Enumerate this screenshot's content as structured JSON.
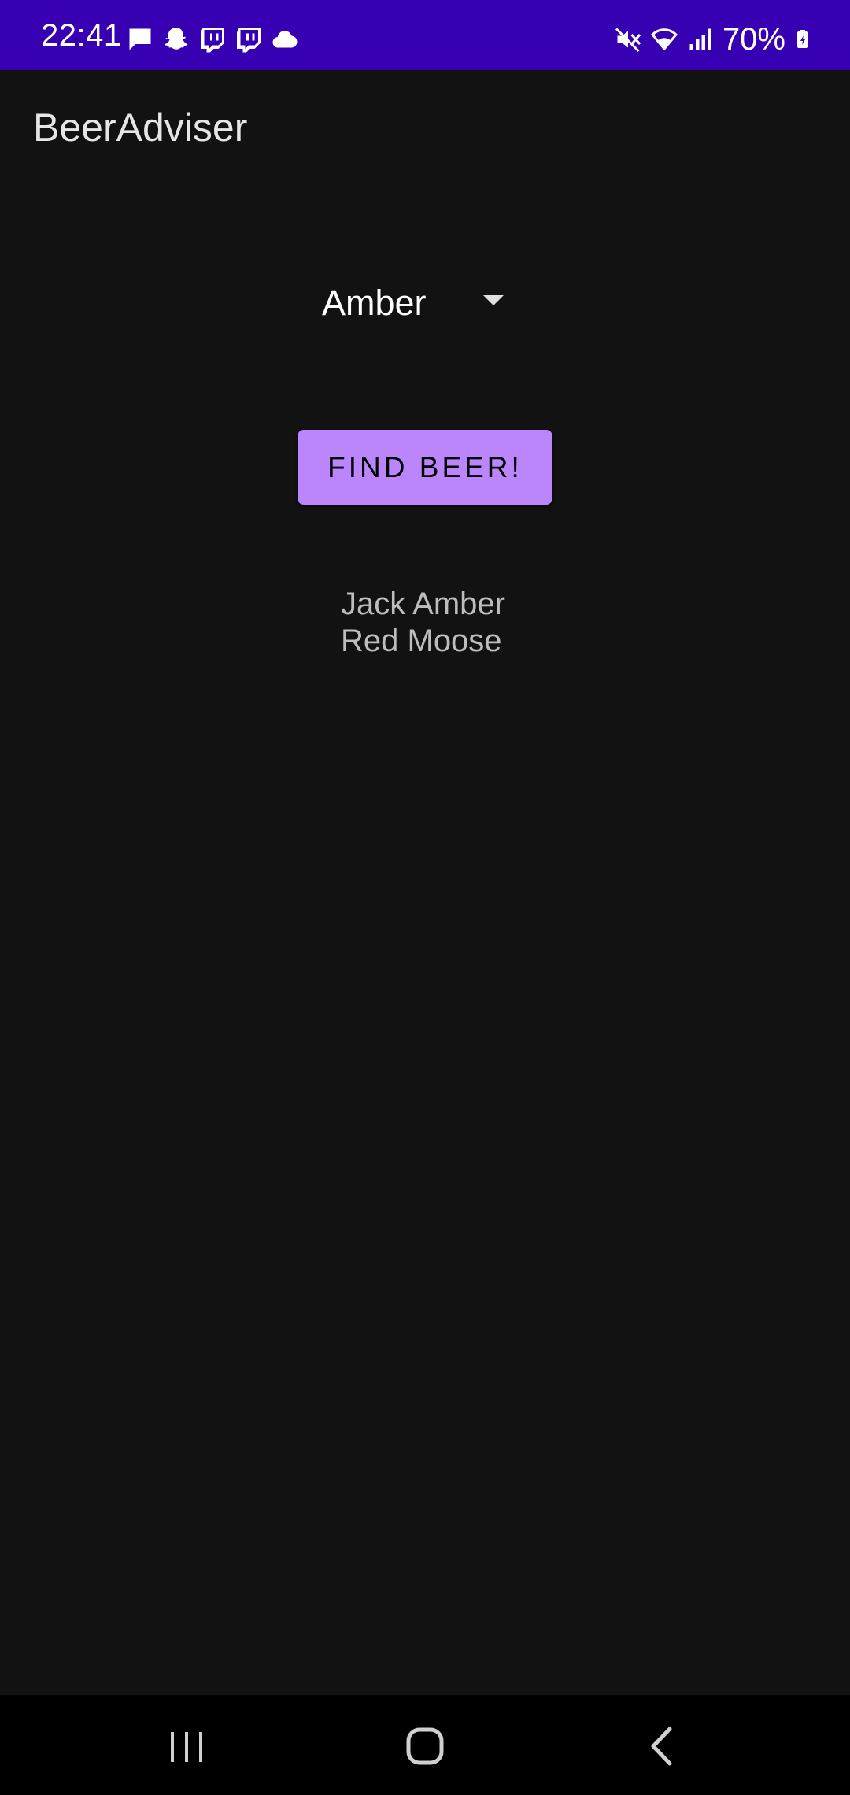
{
  "status_bar": {
    "time": "22:41",
    "battery": "70%",
    "background_color": "#3700b3",
    "left_icons": [
      "message-icon",
      "snapchat-icon",
      "twitch-icon",
      "twitch-icon",
      "cloud-icon"
    ],
    "right_icons": [
      "mute-icon",
      "wifi-icon",
      "signal-icon",
      "battery-icon"
    ]
  },
  "app_bar": {
    "title": "BeerAdviser"
  },
  "spinner": {
    "selected": "Amber"
  },
  "button": {
    "label": "FIND BEER!",
    "color": "#bb86fc"
  },
  "results": {
    "lines": [
      "Jack Amber",
      "Red Moose"
    ]
  },
  "nav_bar": {
    "buttons": [
      "recents-icon",
      "home-icon",
      "back-icon"
    ]
  }
}
